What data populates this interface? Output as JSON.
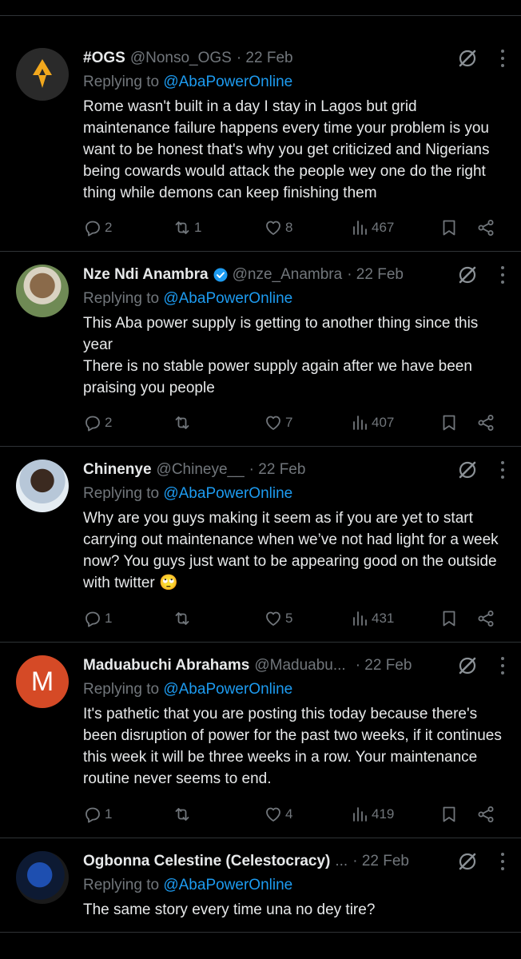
{
  "tweets": [
    {
      "name": "#OGS",
      "handle": "@Nonso_OGS",
      "time": "· 22 Feb",
      "replying_prefix": "Replying to ",
      "replying_to": "@AbaPowerOnline",
      "body": "Rome wasn't built in a day I stay in Lagos but grid maintenance failure happens every time your problem is you want to be honest that's why you get criticized and Nigerians being cowards would attack the people wey one do the right thing while demons can keep finishing them",
      "replies": "2",
      "reposts": "1",
      "likes": "8",
      "views": "467"
    },
    {
      "name": "Nze Ndi Anambra",
      "verified": true,
      "handle": "@nze_Anambra",
      "time": "· 22 Feb",
      "replying_prefix": "Replying to ",
      "replying_to": "@AbaPowerOnline",
      "body_line1": "This Aba power supply is getting to another thing since this year",
      "body_line2": "There is no stable power supply again after we have been praising you people",
      "replies": "2",
      "reposts": "",
      "likes": "7",
      "views": "407"
    },
    {
      "name": "Chinenye",
      "handle": "@Chineye__",
      "time": "· 22 Feb",
      "replying_prefix": "Replying to ",
      "replying_to": "@AbaPowerOnline",
      "body": "Why are you guys making it seem as if you are yet to start carrying out maintenance when we’ve not had light for a week now? You guys just want to be appearing good on the outside with twitter 🙄",
      "replies": "1",
      "reposts": "",
      "likes": "5",
      "views": "431"
    },
    {
      "name": "Maduabuchi Abrahams",
      "avatar_letter": "M",
      "handle": "@Maduabu...",
      "time": "· 22 Feb",
      "replying_prefix": "Replying to ",
      "replying_to": "@AbaPowerOnline",
      "body": "It's pathetic that you are posting this today because there's been disruption of power for the past two weeks, if it continues this week it will be three weeks in a row. Your maintenance routine never seems to end.",
      "replies": "1",
      "reposts": "",
      "likes": "4",
      "views": "419"
    },
    {
      "name": "Ogbonna Celestine (Celestocracy)",
      "handle": "...",
      "time": "· 22 Feb",
      "replying_prefix": "Replying to ",
      "replying_to": "@AbaPowerOnline",
      "body": "The same story every time una no dey tire?"
    }
  ],
  "icons": {
    "reply": "reply-icon",
    "repost": "repost-icon",
    "like": "heart-icon",
    "views": "views-icon",
    "bookmark": "bookmark-icon",
    "share": "share-icon",
    "grok": "grok-icon",
    "more": "more-icon"
  },
  "colors": {
    "background": "#000000",
    "text": "#e7e9ea",
    "muted": "#71767b",
    "link": "#1d9bf0",
    "separator": "#2f3336",
    "verified": "#1d9bf0"
  }
}
